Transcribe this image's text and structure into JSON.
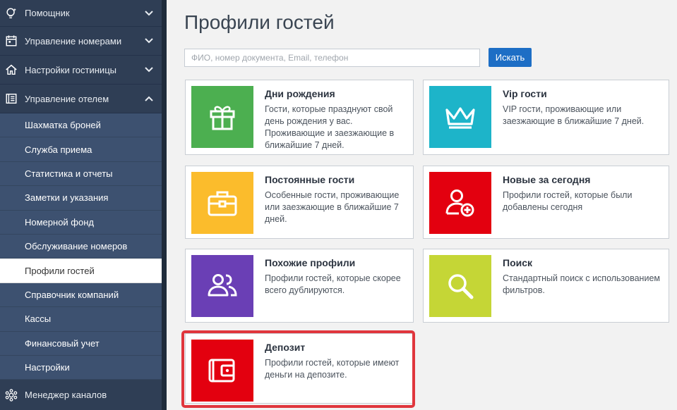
{
  "sidebar": {
    "top_items": [
      {
        "label": "Помощник",
        "icon": "bulb-icon",
        "expanded": false
      },
      {
        "label": "Управление номерами",
        "icon": "calendar-icon",
        "expanded": false
      },
      {
        "label": "Настройки гостиницы",
        "icon": "home-icon",
        "expanded": false
      },
      {
        "label": "Управление отелем",
        "icon": "ledger-icon",
        "expanded": true
      }
    ],
    "sub_items": [
      {
        "label": "Шахматка броней",
        "active": false
      },
      {
        "label": "Служба приема",
        "active": false
      },
      {
        "label": "Статистика и отчеты",
        "active": false
      },
      {
        "label": "Заметки и указания",
        "active": false
      },
      {
        "label": "Номерной фонд",
        "active": false
      },
      {
        "label": "Обслуживание номеров",
        "active": false
      },
      {
        "label": "Профили гостей",
        "active": true
      },
      {
        "label": "Справочник компаний",
        "active": false
      },
      {
        "label": "Кассы",
        "active": false
      },
      {
        "label": "Финансовый учет",
        "active": false
      },
      {
        "label": "Настройки",
        "active": false
      }
    ],
    "bottom_item": {
      "label": "Менеджер каналов",
      "icon": "gear-network-icon"
    }
  },
  "main": {
    "title": "Профили гостей",
    "search": {
      "placeholder": "ФИО, номер документа, Email, телефон",
      "value": "",
      "button_label": "Искать"
    },
    "cards": [
      {
        "key": "birthdays",
        "title": "Дни рождения",
        "desc": "Гости, которые празднуют свой день рождения у вас. Проживающие и заезжающие в ближайшие 7 дней.",
        "icon": "gift-icon",
        "color": "#4caf50"
      },
      {
        "key": "vip",
        "title": "Vip гости",
        "desc": "VIP гости, проживающие или заезжающие в ближайшие 7 дней.",
        "icon": "crown-icon",
        "color": "#1db4c9"
      },
      {
        "key": "regular",
        "title": "Постоянные гости",
        "desc": "Особенные гости, проживающие или заезжающие в ближайшие 7 дней.",
        "icon": "briefcase-icon",
        "color": "#fbbc2c"
      },
      {
        "key": "new_today",
        "title": "Новые за сегодня",
        "desc": "Профили гостей, которые были добавлены сегодня",
        "icon": "add-user-icon",
        "color": "#e3000f"
      },
      {
        "key": "similar",
        "title": "Похожие профили",
        "desc": "Профили гостей, которые скорее всего дублируются.",
        "icon": "users-icon",
        "color": "#6a3fb5"
      },
      {
        "key": "search",
        "title": "Поиск",
        "desc": "Стандартный поиск с использованием фильтров.",
        "icon": "magnifier-icon",
        "color": "#c5d636"
      },
      {
        "key": "deposit",
        "title": "Депозит",
        "desc": "Профили гостей, которые имеют деньги на депозите.",
        "icon": "wallet-icon",
        "color": "#e3000f"
      }
    ]
  },
  "colors": {
    "highlight": "#e0363d",
    "sidebar": "#2b3a4f",
    "submenu": "#3d5170",
    "primary": "#1d6ec5"
  }
}
